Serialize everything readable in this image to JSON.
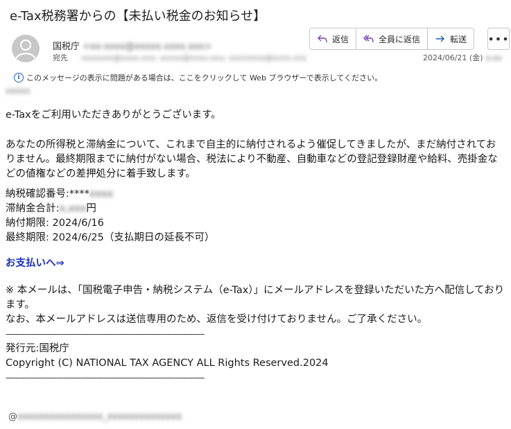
{
  "email": {
    "subject": "e-Tax税務署からの【未払い税金のお知らせ】",
    "sender_name": "国税庁",
    "sender_email": "<xx-xxxx@xxxxx.xxxx.xxx>",
    "to_label": "宛先",
    "to_value": "xxxxxxx@xxxx.xxx; xxxxx@xxxx.xxx; xxxxxxxx@xxxx.xxx",
    "date": "2024/06/21 (金)",
    "date_tail": "x:xx",
    "info_bar": "このメッセージの表示に問題がある場合は、ここをクリックして Web ブラウザーで表示してください。",
    "recipient_line": "xxxxx"
  },
  "toolbar": {
    "reply": "返信",
    "reply_all": "全員に返信",
    "forward": "転送",
    "more": "•••"
  },
  "body": {
    "greeting": "e-Taxをご利用いただきありがとうございます。",
    "main": "あなたの所得税と滞納金について、これまで自主的に納付されるよう催促してきましたが、まだ納付されておりません。最終期限までに納付がない場合、税法により不動産、自動車などの登記登録財産や給料、売掛金などの値権などの差押処分に着手致します。",
    "line1_label": "納税確認番号:****",
    "line1_blur": "xxxx",
    "line2_label": "滞納金合計:",
    "line2_blur": "x,xxx",
    "line2_suffix": "円",
    "line3": "納付期限: 2024/6/16",
    "line4": "最終期限: 2024/6/25（支払期日の延長不可）",
    "pay_link": "お支払いへ⇒",
    "notice": "※ 本メールは、「国税電子申告・納税システム（e-Tax）」にメールアドレスを登録いただいた方へ配信しております。",
    "notice2": "なお、本メールアドレスは送信専用のため、返信を受け付けておりません。ご了承ください。",
    "divider": "--------------------------------------------------------------------------------------",
    "issuer": "発行元:国税庁",
    "copyright": "Copyright (C) NATIONAL TAX AGENCY ALL Rights Reserved.2024",
    "footer_at": "@",
    "footer_blur": "xxxxxxxxxxxxxxxx_xxxxxxxxxxxxxx"
  },
  "colors": {
    "link": "#1a2fb8",
    "avatar": "#c7c7c7",
    "info_icon": "#1a5fb4"
  }
}
